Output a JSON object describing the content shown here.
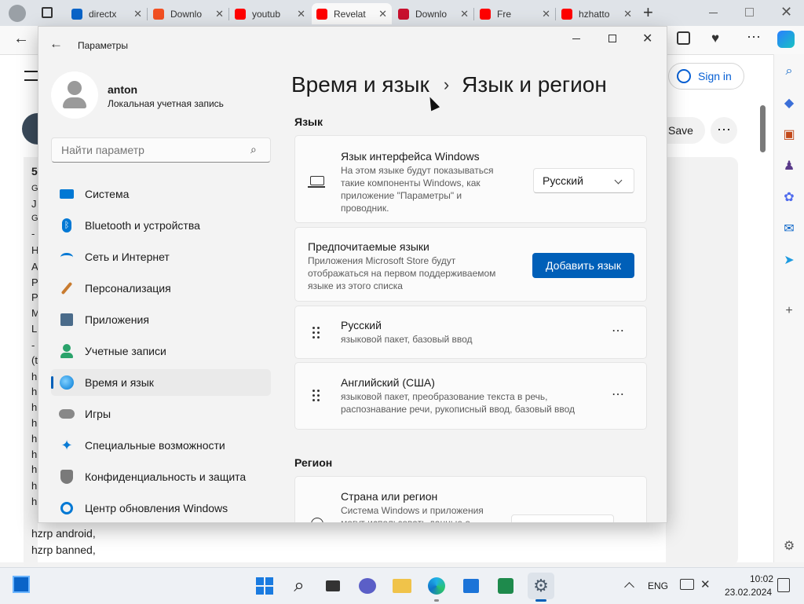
{
  "browser": {
    "tabs": [
      {
        "title": "directx",
        "favicon": "search-icon",
        "color": "#0a64c8"
      },
      {
        "title": "Downlo",
        "favicon": "microsoft-logo-icon",
        "color": "#f25022"
      },
      {
        "title": "youtub",
        "favicon": "youtube-icon",
        "color": "#ff0000"
      },
      {
        "title": "Revelat",
        "favicon": "youtube-icon",
        "color": "#ff0000"
      },
      {
        "title": "Downlo",
        "favicon": "m-logo-icon",
        "color": "#c8102e"
      },
      {
        "title": "Fre",
        "favicon": "youtube-icon",
        "color": "#ff0000"
      },
      {
        "title": "hzhatto",
        "favicon": "youtube-icon",
        "color": "#ff0000"
      }
    ],
    "new_tab_glyph": "+",
    "sign_in_label": "Sign in",
    "save_label": "Save",
    "page_lines": [
      "hzrp android,",
      "hzrp banned,"
    ],
    "page_fragments": [
      "5",
      "G",
      "J",
      "G",
      "-",
      "H",
      "A",
      "P",
      "P",
      "M",
      "L",
      "-",
      "(t",
      "h",
      "h",
      "h",
      "h",
      "h",
      "h",
      "h",
      "h",
      "h"
    ]
  },
  "settings": {
    "window_title": "Параметры",
    "user": {
      "name": "anton",
      "account_type": "Локальная учетная запись"
    },
    "search_placeholder": "Найти параметр",
    "nav": [
      {
        "label": "Система",
        "icon": "monitor-icon",
        "color": "#0078d4"
      },
      {
        "label": "Bluetooth и устройства",
        "icon": "bluetooth-icon",
        "color": "#0078d4"
      },
      {
        "label": "Сеть и Интернет",
        "icon": "wifi-icon",
        "color": "#0078d4"
      },
      {
        "label": "Персонализация",
        "icon": "brush-icon",
        "color": "#c87b2f"
      },
      {
        "label": "Приложения",
        "icon": "apps-icon",
        "color": "#4a6b8a"
      },
      {
        "label": "Учетные записи",
        "icon": "person-icon",
        "color": "#2aa36b"
      },
      {
        "label": "Время и язык",
        "icon": "globe-clock-icon",
        "color": "#0078d4",
        "selected": true
      },
      {
        "label": "Игры",
        "icon": "gamepad-icon",
        "color": "#888888"
      },
      {
        "label": "Специальные возможности",
        "icon": "accessibility-icon",
        "color": "#0a7bd4"
      },
      {
        "label": "Конфиденциальность и защита",
        "icon": "shield-icon",
        "color": "#7a7a7a"
      },
      {
        "label": "Центр обновления Windows",
        "icon": "update-icon",
        "color": "#0078d4"
      }
    ],
    "breadcrumb": {
      "parent": "Время и язык",
      "separator": "›",
      "current": "Язык и регион"
    },
    "language_section": "Язык",
    "display_language": {
      "title": "Язык интерфейса Windows",
      "description": "На этом языке будут показываться такие компоненты Windows, как приложение \"Параметры\" и проводник.",
      "selected": "Русский"
    },
    "preferred": {
      "title": "Предпочитаемые языки",
      "description": "Приложения Microsoft Store будут отображаться на первом поддерживаемом языке из этого списка",
      "add_button": "Добавить язык"
    },
    "languages": [
      {
        "name": "Русский",
        "features": "языковой пакет, базовый ввод"
      },
      {
        "name": "Английский (США)",
        "features": "языковой пакет, преобразование текста в речь, распознавание речи, рукописный ввод, базовый ввод"
      }
    ],
    "region_section": "Регион",
    "country": {
      "title": "Страна или регион",
      "description": "Система Windows и приложения могут использовать данные о"
    }
  },
  "taskbar": {
    "lang": "ENG",
    "time": "10:02",
    "date": "23.02.2024"
  },
  "colors": {
    "accent": "#005fb8",
    "button_text": "#ffffff"
  }
}
